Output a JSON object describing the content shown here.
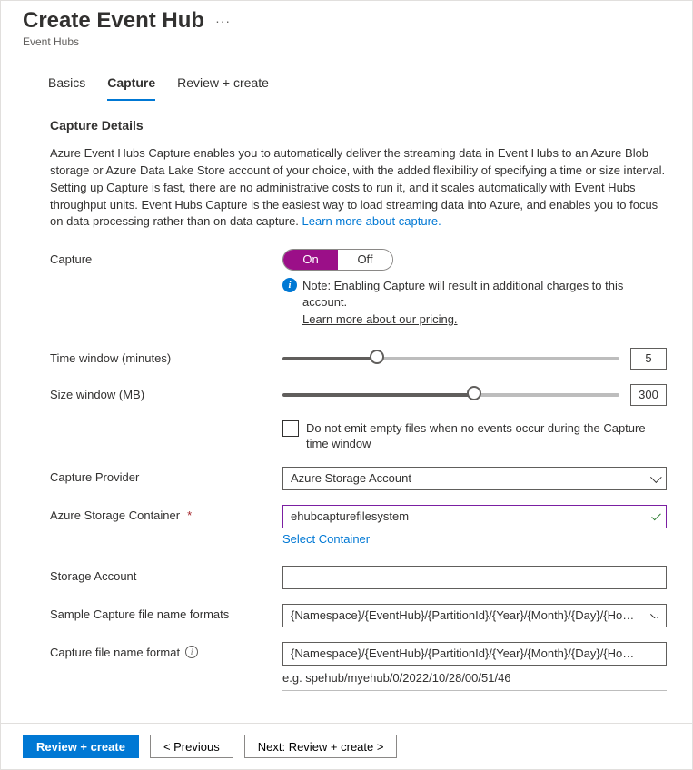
{
  "header": {
    "title": "Create Event Hub",
    "breadcrumb": "Event Hubs"
  },
  "tabs": [
    "Basics",
    "Capture",
    "Review + create"
  ],
  "active_tab": "Capture",
  "section": {
    "title": "Capture Details",
    "description": "Azure Event Hubs Capture enables you to automatically deliver the streaming data in Event Hubs to an Azure Blob storage or Azure Data Lake Store account of your choice, with the added flexibility of specifying a time or size interval. Setting up Capture is fast, there are no administrative costs to run it, and it scales automatically with Event Hubs throughput units. Event Hubs Capture is the easiest way to load streaming data into Azure, and enables you to focus on data processing rather than on data capture. ",
    "learn_more": "Learn more about capture."
  },
  "capture": {
    "label": "Capture",
    "options": {
      "on": "On",
      "off": "Off"
    },
    "selected": "On",
    "note": "Note: Enabling Capture will result in additional charges to this account.",
    "note_link": "Learn more about our pricing."
  },
  "time_window": {
    "label": "Time window (minutes)",
    "value": "5",
    "percent": "28%"
  },
  "size_window": {
    "label": "Size window (MB)",
    "value": "300",
    "percent": "57%"
  },
  "skip_empty": {
    "label": "Do not emit empty files when no events occur during the Capture time window",
    "checked": false
  },
  "provider": {
    "label": "Capture Provider",
    "value": "Azure Storage Account"
  },
  "container": {
    "label": "Azure Storage Container",
    "value": "ehubcapturefilesystem",
    "link": "Select Container"
  },
  "storage_account": {
    "label": "Storage Account",
    "value": ""
  },
  "sample_formats": {
    "label": "Sample Capture file name formats",
    "value": "{Namespace}/{EventHub}/{PartitionId}/{Year}/{Month}/{Day}/{Hour}/{..."
  },
  "file_format": {
    "label": "Capture file name format",
    "value": "{Namespace}/{EventHub}/{PartitionId}/{Year}/{Month}/{Day}/{Hour}/{Min...",
    "example": "e.g. spehub/myehub/0/2022/10/28/00/51/46"
  },
  "footer": {
    "review": "Review + create",
    "previous": "< Previous",
    "next": "Next: Review + create >"
  }
}
